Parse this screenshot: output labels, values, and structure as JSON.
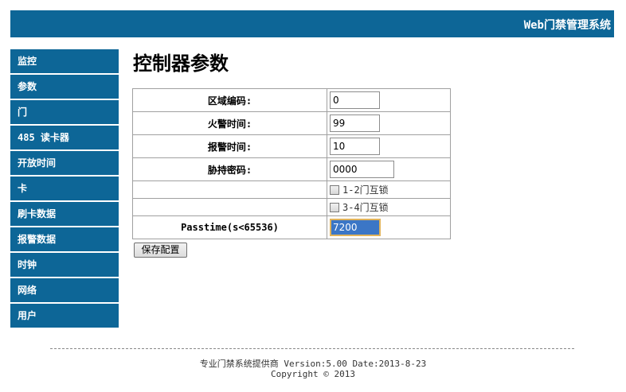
{
  "header": {
    "title": "Web门禁管理系统"
  },
  "sidebar": {
    "items": [
      {
        "label": "监控"
      },
      {
        "label": "参数"
      },
      {
        "label": "门"
      },
      {
        "label": "485 读卡器"
      },
      {
        "label": "开放时间"
      },
      {
        "label": "卡"
      },
      {
        "label": "刷卡数据"
      },
      {
        "label": "报警数据"
      },
      {
        "label": "时钟"
      },
      {
        "label": "网络"
      },
      {
        "label": "用户"
      }
    ]
  },
  "main": {
    "title": "控制器参数",
    "fields": {
      "area_code": {
        "label": "区域编码:",
        "value": "0"
      },
      "fire_alarm_time": {
        "label": "火警时间:",
        "value": "99"
      },
      "alarm_time": {
        "label": "报警时间:",
        "value": "10"
      },
      "duress_password": {
        "label": "胁持密码:",
        "value": "0000"
      },
      "interlock_1_2": {
        "label": "1-2门互锁",
        "checked": false
      },
      "interlock_3_4": {
        "label": "3-4门互锁",
        "checked": false
      },
      "passtime": {
        "label": "Passtime(s<65536)",
        "value": "7200"
      }
    },
    "save_button": "保存配置"
  },
  "footer": {
    "line1": "专业门禁系统提供商 Version:5.00 Date:2013-8-23",
    "line2": "Copyright © 2013"
  },
  "colors": {
    "accent": "#0d6697",
    "focus_border": "#e1b35b",
    "selection": "#3b76c6"
  }
}
